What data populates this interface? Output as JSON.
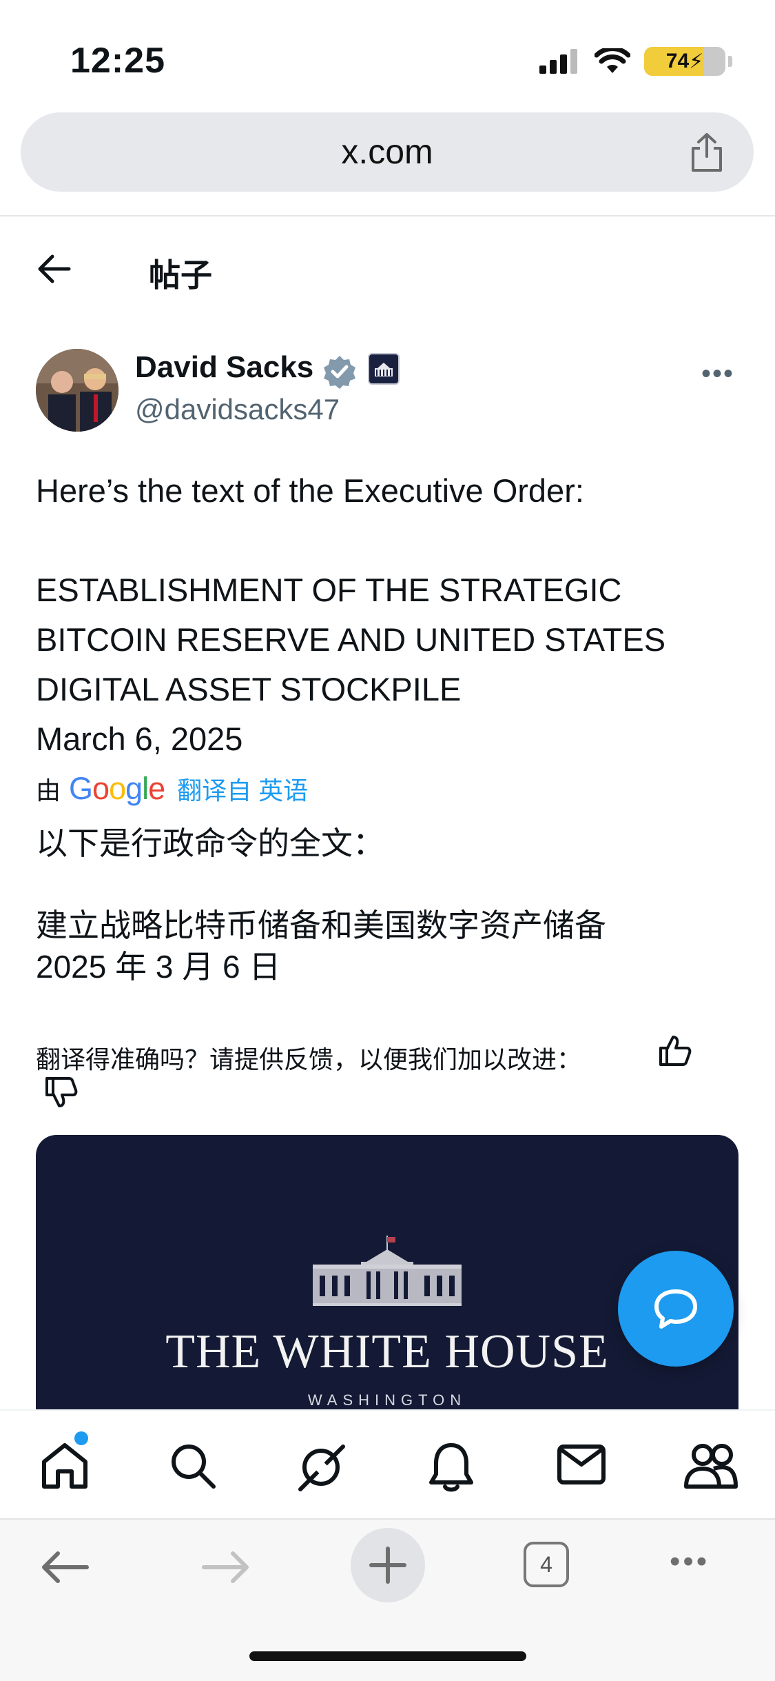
{
  "status_bar": {
    "time": "12:25",
    "battery": "74",
    "battery_level": 0.74
  },
  "browser": {
    "url": "x.com",
    "tab_count": "4"
  },
  "header": {
    "title": "帖子"
  },
  "post": {
    "author_name": "David Sacks",
    "handle": "@davidsacks47",
    "text_intro": "Here’s the text of the Executive Order:",
    "text_title_1": "ESTABLISHMENT OF THE STRATEGIC",
    "text_title_2": "BITCOIN RESERVE AND UNITED STATES",
    "text_title_3": "DIGITAL ASSET STOCKPILE",
    "text_date": "March 6, 2025",
    "translated_by_label": "由",
    "google_logo": "Google",
    "translate_link": "翻译自 英语",
    "translation_intro": "以下是行政命令的全文：",
    "translation_title": "建立战略比特币储备和美国数字资产储备",
    "translation_date": "2025 年 3 月 6 日",
    "feedback_text": "翻译得准确吗？请提供反馈，以便我们加以改进：",
    "card": {
      "title": "THE WHITE HOUSE",
      "subtitle": "WASHINGTON"
    }
  },
  "colors": {
    "accent": "#1d9bf0",
    "card_bg": "#141a35",
    "secondary_text": "#536471"
  },
  "tabbar": {
    "items": [
      "home-icon",
      "search-icon",
      "grok-icon",
      "notifications-icon",
      "messages-icon",
      "communities-icon"
    ]
  }
}
